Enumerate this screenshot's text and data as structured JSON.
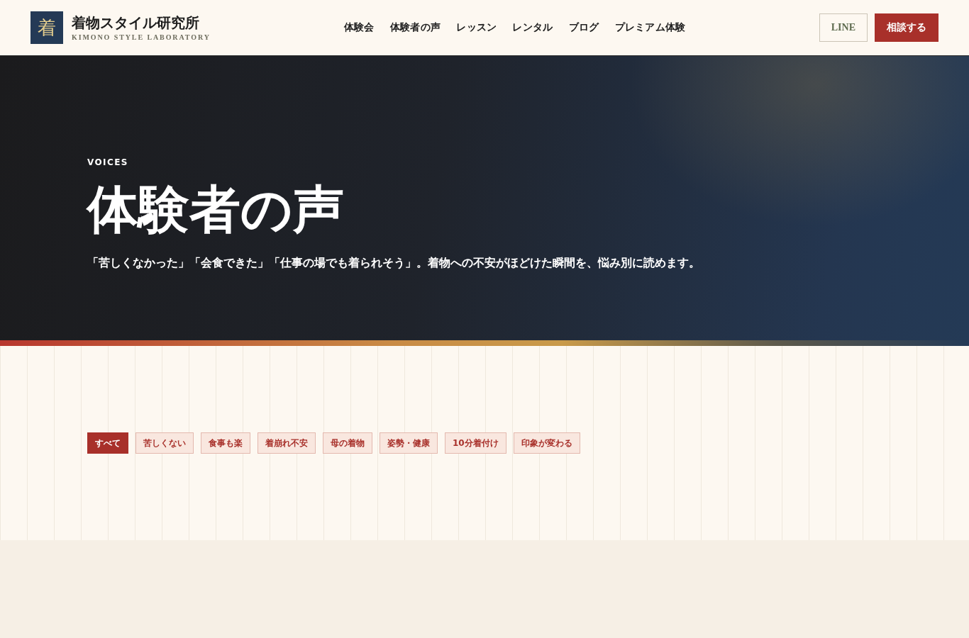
{
  "header": {
    "logo": {
      "mark": "着",
      "title": "着物スタイル研究所",
      "subtitle": "KIMONO STYLE LABORATORY"
    },
    "nav": [
      "体験会",
      "体験者の声",
      "レッスン",
      "レンタル",
      "ブログ",
      "プレミアム体験"
    ],
    "buttons": [
      {
        "label": "LINE",
        "kind": "outline"
      },
      {
        "label": "相談する",
        "kind": "primary"
      }
    ]
  },
  "hero": {
    "eyebrow": "VOICES",
    "title": "体験者の声",
    "lead": "「苦しくなかった」「会食できた」「仕事の場でも着られそう」。着物への不安がほどけた瞬間を、悩み別に読めます。"
  },
  "filters": [
    {
      "label": "すべて",
      "selected": true
    },
    {
      "label": "苦しくない",
      "selected": false
    },
    {
      "label": "食事も楽",
      "selected": false
    },
    {
      "label": "着崩れ不安",
      "selected": false
    },
    {
      "label": "母の着物",
      "selected": false
    },
    {
      "label": "姿勢・健康",
      "selected": false
    },
    {
      "label": "10分着付け",
      "selected": false
    },
    {
      "label": "印象が変わる",
      "selected": false
    }
  ]
}
